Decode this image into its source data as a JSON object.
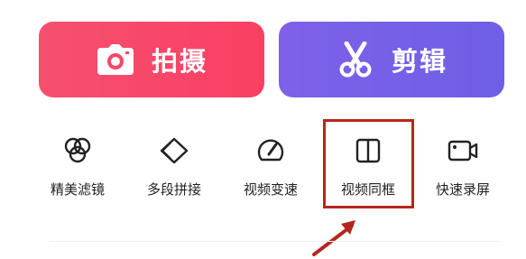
{
  "main_actions": {
    "shoot": {
      "label": "拍摄",
      "icon": "camera-icon",
      "color": "#f6506f"
    },
    "edit": {
      "label": "剪辑",
      "icon": "scissors-icon",
      "color": "#7561e7"
    }
  },
  "tools": [
    {
      "label": "精美滤镜",
      "icon": "filter-icon"
    },
    {
      "label": "多段拼接",
      "icon": "splice-icon"
    },
    {
      "label": "视频变速",
      "icon": "speed-icon"
    },
    {
      "label": "视频同框",
      "icon": "split-frame-icon"
    },
    {
      "label": "快速录屏",
      "icon": "screen-record-icon"
    }
  ],
  "annotation": {
    "highlight_color": "#b5261e"
  }
}
